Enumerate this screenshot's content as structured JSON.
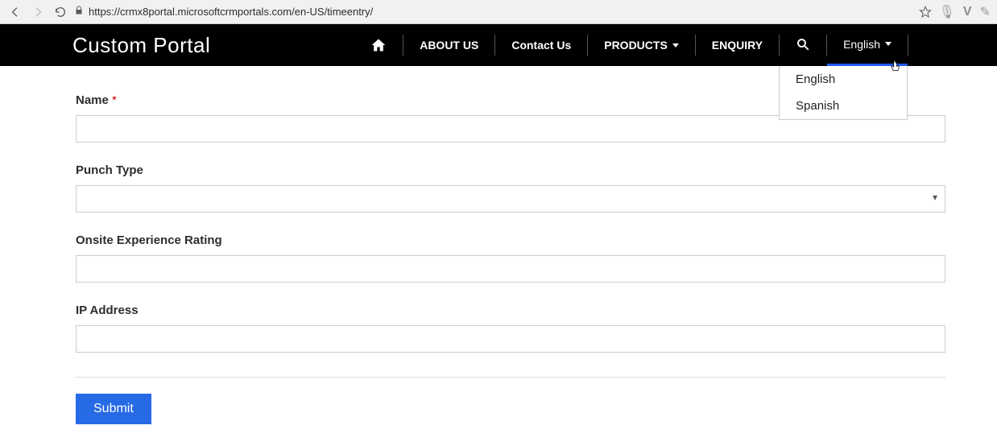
{
  "browser": {
    "url": "https://crmx8portal.microsoftcrmportals.com/en-US/timeentry/"
  },
  "brand": "Custom Portal",
  "nav": {
    "about": "ABOUT US",
    "contact": "Contact Us",
    "products": "PRODUCTS",
    "enquiry": "ENQUIRY",
    "language_current": "English",
    "language_options": [
      "English",
      "Spanish"
    ]
  },
  "form": {
    "name_label": "Name",
    "required_mark": "*",
    "punch_type_label": "Punch Type",
    "rating_label": "Onsite Experience Rating",
    "ip_label": "IP Address",
    "submit_label": "Submit"
  }
}
